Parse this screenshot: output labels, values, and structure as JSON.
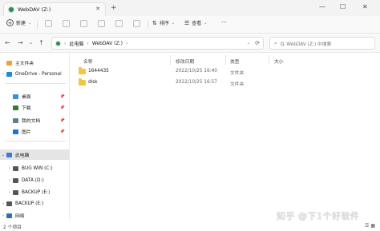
{
  "window": {
    "tab_title": "WebDAV (Z:)",
    "tab_close": "✕",
    "new_tab": "+",
    "minimize": "—",
    "maximize": "☐",
    "close": "✕"
  },
  "toolbar": {
    "new_label": "新建",
    "new_icon": "+",
    "sort_label": "排序",
    "view_label": "查看",
    "more": "···"
  },
  "nav": {
    "back": "←",
    "forward": "→",
    "up": "↑",
    "refresh": "⟳",
    "dropdown": "⌄"
  },
  "breadcrumb": {
    "items": [
      "此电脑",
      "WebDAV (Z:)"
    ],
    "separator": "›"
  },
  "search": {
    "placeholder": "在 WebDAV (Z:) 中搜索",
    "icon": "⌕"
  },
  "sidebar": {
    "items": [
      {
        "label": "主文件夹",
        "chevron": "",
        "icon_color": "#e8a33c"
      },
      {
        "label": "OneDrive - Personal",
        "chevron": "›",
        "icon_color": "#1e88e5"
      },
      {
        "label": "桌面",
        "chevron": "",
        "icon_color": "#3c8fd6",
        "pin": "📌"
      },
      {
        "label": "下载",
        "chevron": "",
        "icon_color": "#2e7d32",
        "pin": "📌"
      },
      {
        "label": "我的文档",
        "chevron": "",
        "icon_color": "#607d8b",
        "pin": "📌"
      },
      {
        "label": "图片",
        "chevron": "",
        "icon_color": "#1976d2",
        "pin": "📌"
      },
      {
        "label": "此电脑",
        "chevron": "⌄",
        "icon_color": "#3a7bd5"
      },
      {
        "label": "BUG WIN (C:)",
        "chevron": "›",
        "icon_color": "#555555"
      },
      {
        "label": "DATA (D:)",
        "chevron": "›",
        "icon_color": "#555555"
      },
      {
        "label": "BACKUP (E:)",
        "chevron": "›",
        "icon_color": "#555555"
      },
      {
        "label": "BACKUP (E:)",
        "chevron": "›",
        "icon_color": "#555555"
      },
      {
        "label": "网络",
        "chevron": "›",
        "icon_color": "#2f6fb3"
      }
    ]
  },
  "columns": {
    "name": "名称",
    "date": "修改日期",
    "type": "类型",
    "size": "大小"
  },
  "files": [
    {
      "name": "1644435",
      "date": "2022/10/25 16:40",
      "type": "文件夹",
      "size": ""
    },
    {
      "name": "disk",
      "date": "2022/10/25 16:57",
      "type": "文件夹",
      "size": ""
    }
  ],
  "status": {
    "count": "2 个项目"
  },
  "watermark": "知乎 @下1个好软件",
  "view_icons": "☰ ▦"
}
